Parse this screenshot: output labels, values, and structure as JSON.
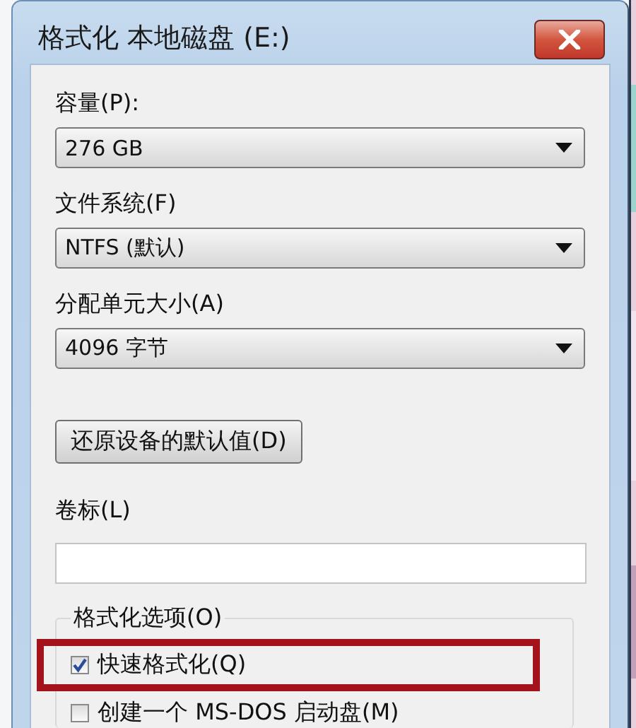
{
  "window": {
    "title": "格式化 本地磁盘 (E:)"
  },
  "fields": [
    {
      "kind": "dropdown",
      "label": "容量(P):",
      "value": "276 GB"
    },
    {
      "kind": "dropdown",
      "label": "文件系统(F)",
      "value": "NTFS (默认)"
    },
    {
      "kind": "dropdown",
      "label": "分配单元大小(A)",
      "value": "4096 字节"
    },
    {
      "kind": "button",
      "label": "还原设备的默认值(D)"
    },
    {
      "kind": "textbox",
      "label": "卷标(L)"
    }
  ],
  "format_options": {
    "title": "格式化选项(O)",
    "options": [
      {
        "label": "快速格式化(Q)",
        "checked": true,
        "highlighted": true
      },
      {
        "label": "创建一个 MS-DOS 启动盘(M)",
        "checked": false,
        "highlighted": false
      }
    ]
  }
}
